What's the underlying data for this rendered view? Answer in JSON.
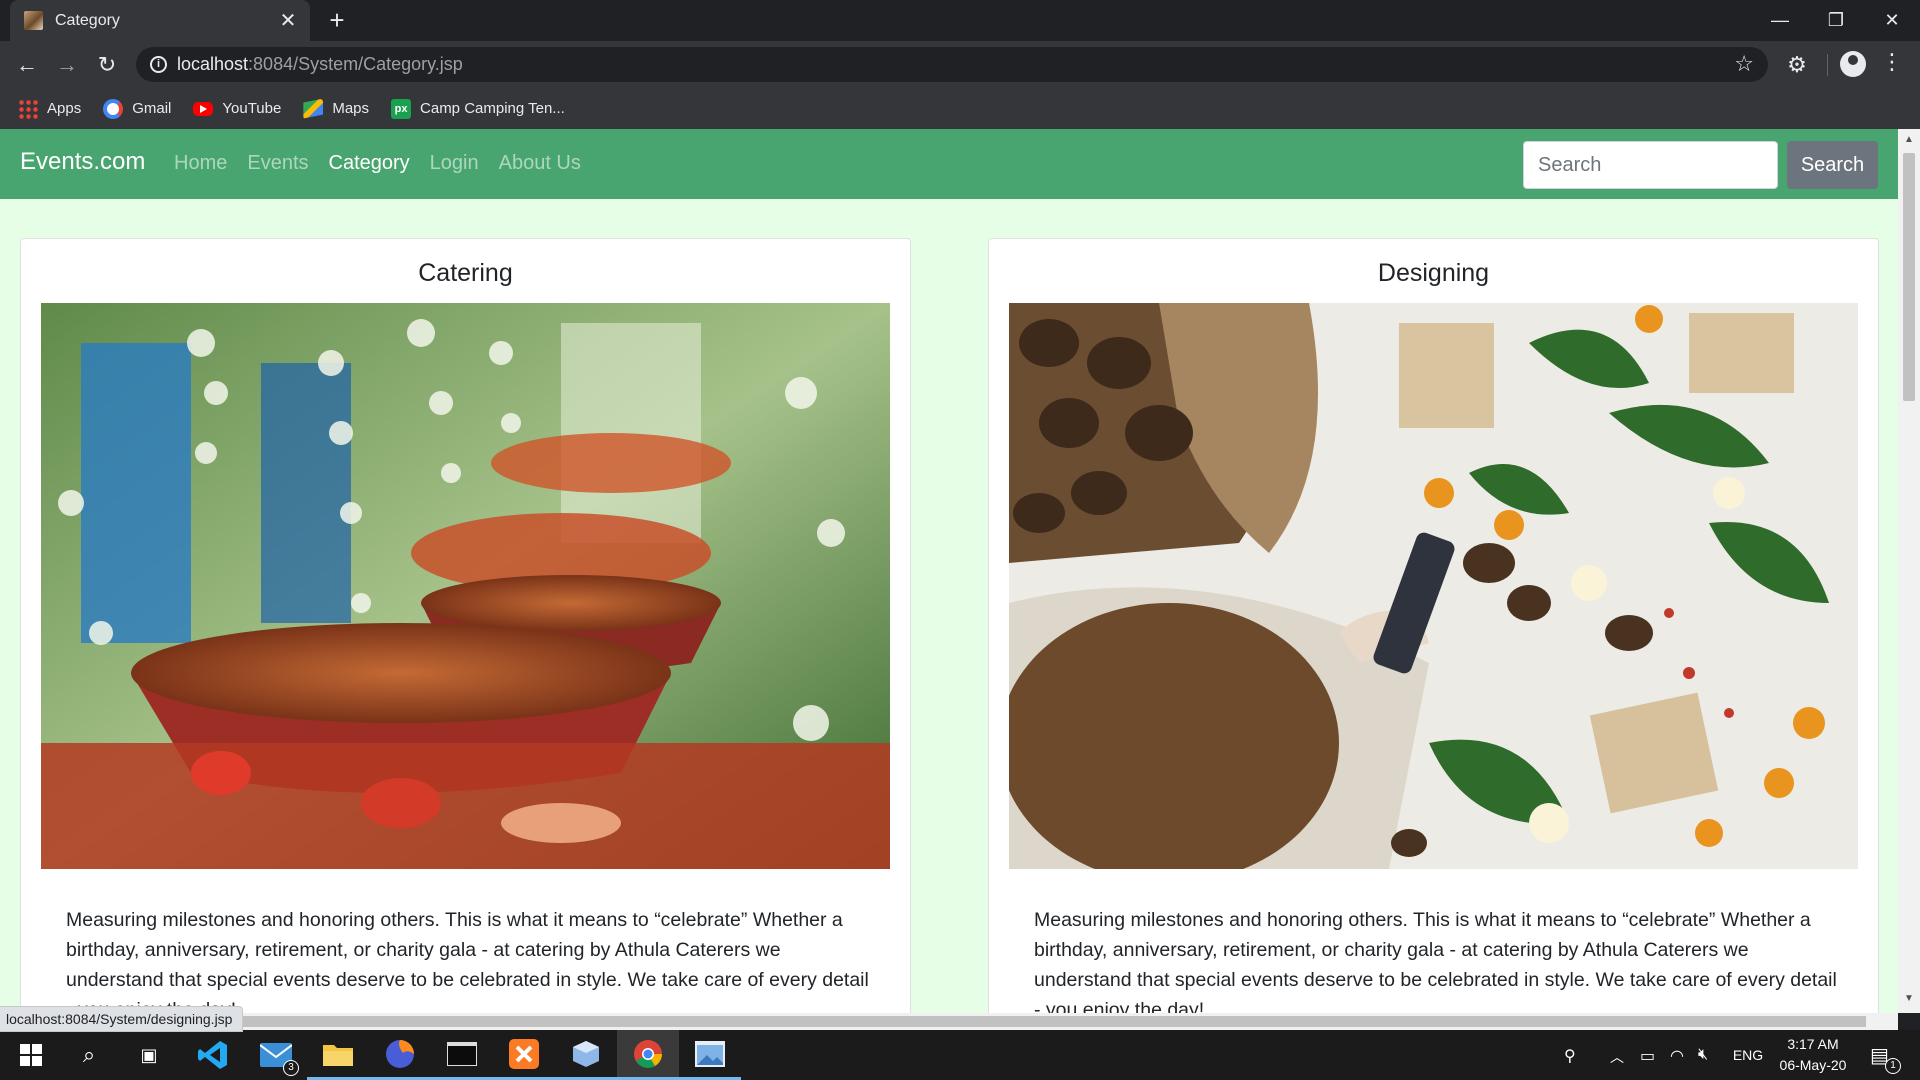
{
  "browser": {
    "tab_title": "Category",
    "url_host": "localhost",
    "url_rest": ":8084/System/Category.jsp",
    "status_url": "localhost:8084/System/designing.jsp",
    "bookmarks": [
      {
        "label": "Apps",
        "icon": "apps-icon"
      },
      {
        "label": "Gmail",
        "icon": "gmail-icon"
      },
      {
        "label": "YouTube",
        "icon": "youtube-icon"
      },
      {
        "label": "Maps",
        "icon": "maps-icon"
      },
      {
        "label": "Camp Camping Ten...",
        "icon": "px-icon",
        "icon_text": "px"
      }
    ]
  },
  "site": {
    "brand": "Events.com",
    "nav": [
      {
        "label": "Home",
        "active": false
      },
      {
        "label": "Events",
        "active": false
      },
      {
        "label": "Category",
        "active": true
      },
      {
        "label": "Login",
        "active": false
      },
      {
        "label": "About Us",
        "active": false
      }
    ],
    "search": {
      "placeholder": "Search",
      "value": "",
      "button_label": "Search"
    },
    "accent_color": "#48a56f",
    "page_background": "#e6fde6"
  },
  "cards": [
    {
      "title": "Catering",
      "image_subject": "buffet food bowls with hanging flowers",
      "text": "Measuring milestones and honoring others. This is what it means to “celebrate” Whether a birthday, anniversary, retirement, or charity gala - at catering by Athula Caterers we understand that special events deserve to be celebrated in style. We take care of every detail - you enjoy the day!"
    },
    {
      "title": "Designing",
      "image_subject": "crafting christmas decorations with pine cones and a glue gun",
      "text": "Measuring milestones and honoring others. This is what it means to “celebrate” Whether a birthday, anniversary, retirement, or charity gala - at catering by Athula Caterers we understand that special events deserve to be celebrated in style. We take care of every detail - you enjoy the day!"
    }
  ],
  "taskbar": {
    "apps": [
      "start-icon",
      "search-icon",
      "task-view-icon",
      "vscode-icon",
      "mail-icon",
      "file-explorer-icon",
      "firefox-icon",
      "terminal-icon",
      "xampp-icon",
      "virtualbox-icon",
      "chrome-icon",
      "photos-icon"
    ],
    "mail_badge": "3",
    "language": "ENG",
    "time": "3:17 AM",
    "date": "06-May-20",
    "notification_badge": "1"
  }
}
